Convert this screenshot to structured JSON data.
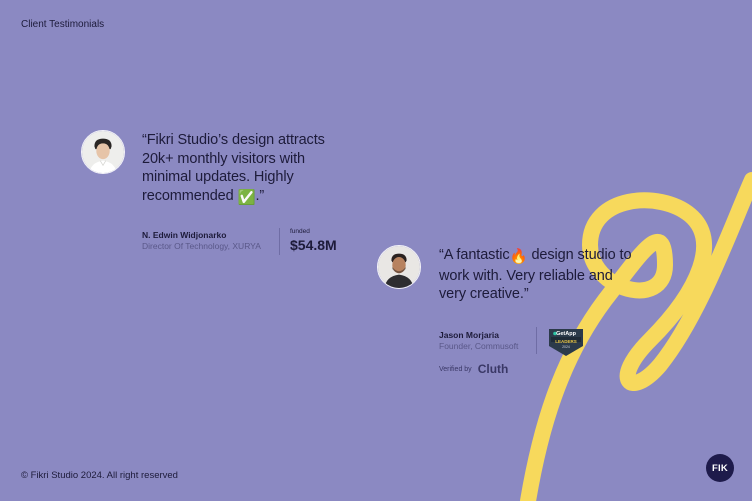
{
  "header": {
    "section_label": "Client Testimonials"
  },
  "testimonials": [
    {
      "quote_text": "“Fikri Studio’s design attracts 20k+ monthly visitors with minimal updates. Highly recommended",
      "quote_end": ".”",
      "emoji": "✅",
      "name": "N. Edwin Widjonarko",
      "role": "Director Of Technology, XURYA",
      "funded_label": "funded",
      "funded_value": "$54.8M"
    },
    {
      "quote_start": "“A fantastic",
      "emoji": "🔥",
      "quote_text": "design studio to work with. Very reliable and very creative.”",
      "name": "Jason Morjaria",
      "role": "Founder, Commusoft",
      "badge_top": "GetApp",
      "badge_bottom": "LEADERS",
      "badge_year": "2024",
      "verified_label": "Verified by",
      "verified_brand": "Cluth"
    }
  ],
  "footer": {
    "copyright": "© Fikri Studio 2024. All right reserved"
  },
  "logo": {
    "text": "FIK"
  },
  "colors": {
    "background": "#8b89c2",
    "text_dark": "#1d1b3a",
    "squiggle": "#f7d95c",
    "logo_bg": "#1e1b4b"
  }
}
